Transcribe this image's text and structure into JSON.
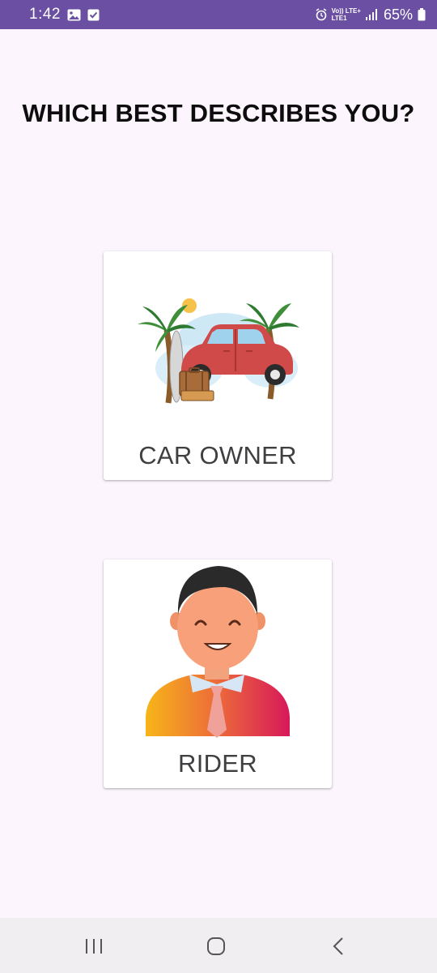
{
  "status_bar": {
    "time": "1:42",
    "network_top": "Vo)) LTE+",
    "network_bottom": "LTE1",
    "battery": "65%",
    "icons": [
      "gallery-icon",
      "check-box-icon",
      "alarm-icon",
      "signal-icon",
      "battery-icon"
    ]
  },
  "page": {
    "title": "WHICH BEST DESCRIBES YOU?"
  },
  "options": {
    "car_owner": {
      "label": "CAR OWNER",
      "icon": "car-illustration"
    },
    "rider": {
      "label": "RIDER",
      "icon": "person-illustration"
    }
  },
  "nav_bar": {
    "icons": [
      "recents-icon",
      "home-icon",
      "back-icon"
    ]
  },
  "colors": {
    "status_bar": "#6a4fa3",
    "background": "#fcf5fd",
    "card": "#ffffff",
    "car": "#d04a4a",
    "rider_shirt_start": "#f7b518",
    "rider_shirt_end": "#d7185a"
  }
}
